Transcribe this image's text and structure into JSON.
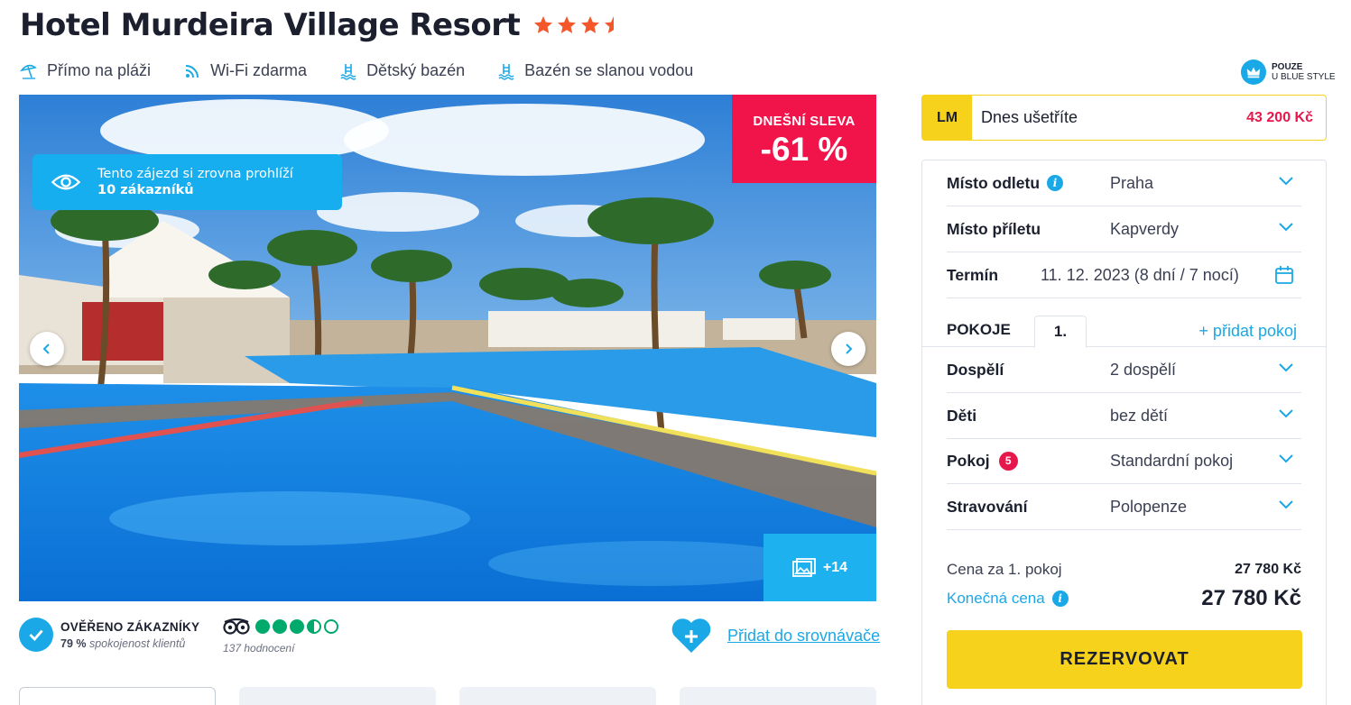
{
  "hotel": {
    "name": "Hotel Murdeira Village Resort",
    "stars": 3.5
  },
  "amenities": [
    {
      "label": "Přímo na pláži",
      "icon": "beach-umbrella-icon"
    },
    {
      "label": "Wi-Fi zdarma",
      "icon": "wifi-icon"
    },
    {
      "label": "Dětský bazén",
      "icon": "kids-pool-icon"
    },
    {
      "label": "Bazén se slanou vodou",
      "icon": "saltwater-pool-icon"
    }
  ],
  "blue_style": {
    "line1": "POUZE",
    "line2": "U BLUE STYLE"
  },
  "gallery": {
    "viewers_line1": "Tento zájezd si zrovna prohlíží",
    "viewers_line2": "10 zákazníků",
    "discount_label": "DNEŠNÍ SLEVA",
    "discount_value": "-61 %",
    "more_photos": "+14"
  },
  "verified": {
    "title": "OVĚŘENO ZÁKAZNÍKY",
    "percent": "79 %",
    "subtitle": "spokojenost klientů"
  },
  "tripadvisor": {
    "rating": 3.5,
    "count": "137 hodnocení"
  },
  "compare": {
    "label": "Přidat do srovnávače"
  },
  "lm": {
    "badge": "LM",
    "text": "Dnes ušetříte",
    "amount": "43 200 Kč"
  },
  "booking": {
    "departure_label": "Místo odletu",
    "departure_value": "Praha",
    "arrival_label": "Místo příletu",
    "arrival_value": "Kapverdy",
    "term_label": "Termín",
    "term_value": "11. 12. 2023 (8 dní / 7 nocí)",
    "rooms_label": "POKOJE",
    "room_tab": "1.",
    "add_room": "+ přidat pokoj",
    "adults_label": "Dospělí",
    "adults_value": "2 dospělí",
    "children_label": "Děti",
    "children_value": "bez dětí",
    "room_label": "Pokoj",
    "room_badge": "5",
    "room_value": "Standardní pokoj",
    "board_label": "Stravování",
    "board_value": "Polopenze",
    "price_per_room_label": "Cena za 1. pokoj",
    "price_per_room": "27 780 Kč",
    "final_price_label": "Konečná cena",
    "final_price": "27 780 Kč",
    "reserve_label": "REZERVOVAT"
  },
  "colors": {
    "accent_blue": "#1ba8e6",
    "discount_red": "#f0144a",
    "reserve_yellow": "#f6d21c",
    "star_orange": "#f4572a",
    "tripadvisor_green": "#00aa6c"
  }
}
